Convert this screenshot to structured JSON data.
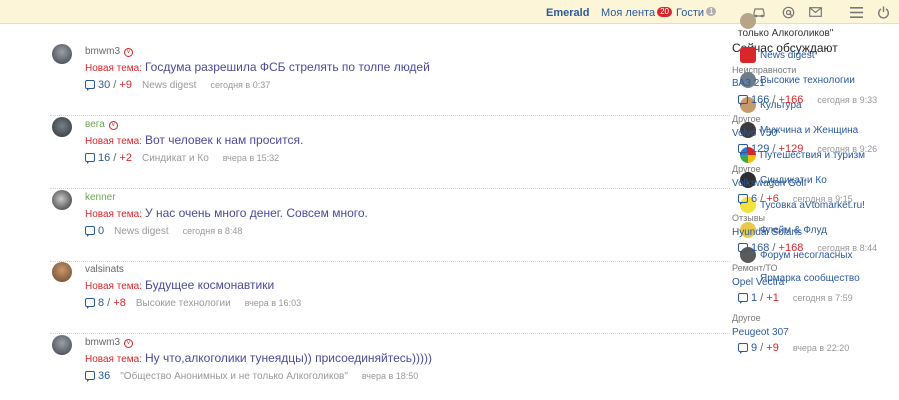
{
  "topbar": {
    "emerald": "Emerald",
    "feed_label": "Моя лента",
    "feed_badge": "20",
    "guests_label": "Гости",
    "guests_badge": "1"
  },
  "feed": [
    {
      "author": "bmwm3",
      "author_color": "#666666",
      "label": "Новая тема:",
      "title": "Госдума разрешила ФСБ стрелять по толпе людей",
      "comments": "30",
      "plus": "+9",
      "blog": "News digest",
      "time": "сегодня в 0:37"
    },
    {
      "author": "вега",
      "author_color": "#6aa84f",
      "label": "Новая тема:",
      "title": "Вот человек к нам просится.",
      "comments": "16",
      "plus": "+2",
      "blog": "Синдикат и Ко",
      "time": "вчера в 15:32"
    },
    {
      "author": "kenner",
      "author_color": "#6aa84f",
      "label": "Новая тема:",
      "title": "У нас очень много денег. Совсем много.",
      "comments": "0",
      "plus": "",
      "blog": "News digest",
      "time": "сегодня в 8:48"
    },
    {
      "author": "valsinats",
      "author_color": "#666666",
      "label": "Новая тема:",
      "title": "Будущее космонавтики",
      "comments": "8",
      "plus": "+8",
      "blog": "Высокие технологии",
      "time": "вчера в 16:03"
    },
    {
      "author": "bmwm3",
      "author_color": "#666666",
      "label": "Новая тема:",
      "title": "Ну что,алкоголики тунеядцы)) присоединяйтесь)))))",
      "comments": "36",
      "plus": "",
      "blog": "\"Общество Анонимных и не только Алкоголиков\"",
      "time": "вчера в 18:50"
    }
  ],
  "right": {
    "top_fragment": "только Алкоголиков\"",
    "heading": "Сейчас обсуждают",
    "blogs": [
      "News digest",
      "Высокие технологии",
      "Культура",
      "Мужчина и Женщина",
      "Путешествия и туризм",
      "Синдикат и Ко",
      "Тусовка aVtomarket.ru!",
      "Флейм & Флуд",
      "Форум несогласных",
      "Ярмарка сообщество"
    ],
    "categories": [
      "Неисправности",
      "Другое",
      "Другое",
      "Отзывы",
      "Ремонт/ТО",
      "Другое"
    ],
    "cars": [
      "ВАЗ 21",
      "Volvo V50",
      "Volkswagen Golf",
      "Hyundai Solaris",
      "Opel Vectra",
      "Peugeot 307"
    ],
    "counts": [
      {
        "c": "166",
        "p": "+166",
        "t": "сегодня в 9:33"
      },
      {
        "c": "129",
        "p": "+129",
        "t": "сегодня в 9:26"
      },
      {
        "c": "6",
        "p": "+6",
        "t": "сегодня в 9:15"
      },
      {
        "c": "168",
        "p": "+168",
        "t": "сегодня в 8:44"
      },
      {
        "c": "1",
        "p": "+1",
        "t": "сегодня в 7:59"
      },
      {
        "c": "9",
        "p": "+9",
        "t": "вчера в 22:20"
      }
    ]
  },
  "colors": {
    "accent": "#2a5a9a",
    "new": "#d9262b",
    "bar": "#fdf5d8"
  }
}
